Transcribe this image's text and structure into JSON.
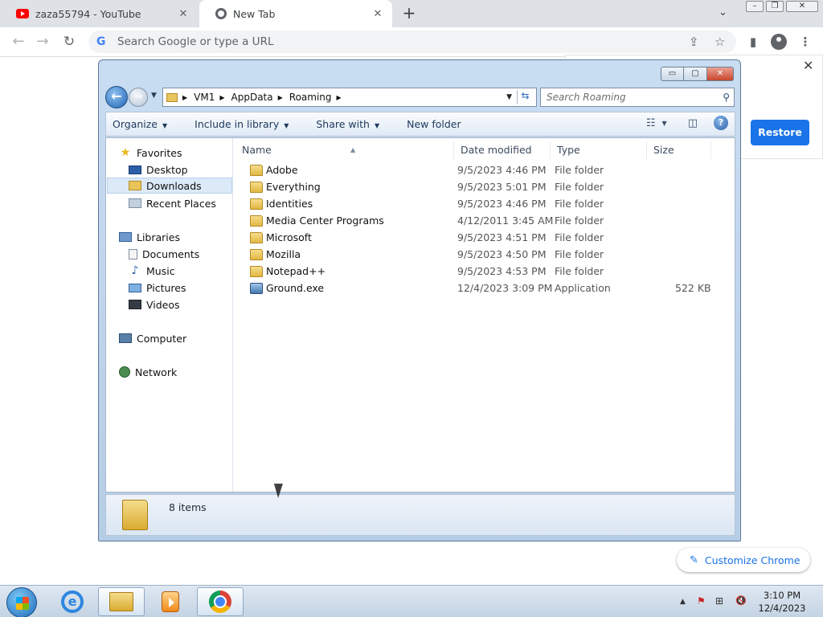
{
  "chrome": {
    "tabs": [
      {
        "title": "zaza55794 - YouTube",
        "close": "✕"
      },
      {
        "title": "New Tab",
        "close": "✕"
      }
    ],
    "new_tab": "+",
    "tab_search": "⌄",
    "window_controls": {
      "minimize": "–",
      "maximize": "❐",
      "close": "✕"
    },
    "nav": {
      "back": "←",
      "forward": "→",
      "reload": "↻"
    },
    "omnibox": {
      "g": "G",
      "placeholder": "Search Google or type a URL"
    },
    "toolbar_icons": {
      "share": "⇪",
      "bookmark": "☆",
      "sidepanel": "▮",
      "menu": "⋮"
    }
  },
  "ntp": {
    "close": "✕",
    "restore_label": "Restore",
    "customize_label": "Customize Chrome",
    "pencil": "✎"
  },
  "explorer": {
    "caption": {
      "minimize": "▭",
      "maximize": "▢",
      "close": "✕"
    },
    "breadcrumb": [
      "VM1",
      "AppData",
      "Roaming"
    ],
    "breadcrumb_sep": "▶",
    "back": "←",
    "forward": "→",
    "search_placeholder": "Search Roaming",
    "search_icon": "⚲",
    "commands": [
      {
        "label": "Organize",
        "caret": "▼"
      },
      {
        "label": "Include in library",
        "caret": "▼"
      },
      {
        "label": "Share with",
        "caret": "▼"
      },
      {
        "label": "New folder",
        "caret": ""
      }
    ],
    "view_icons": {
      "views": "☷",
      "views_caret": "▼",
      "preview": "◫",
      "help": "?"
    },
    "nav_pane": {
      "favorites": {
        "label": "Favorites",
        "items": [
          "Desktop",
          "Downloads",
          "Recent Places"
        ]
      },
      "libraries": {
        "label": "Libraries",
        "items": [
          "Documents",
          "Music",
          "Pictures",
          "Videos"
        ]
      },
      "computer": "Computer",
      "network": "Network"
    },
    "columns": [
      "Name",
      "Date modified",
      "Type",
      "Size"
    ],
    "files": [
      {
        "name": "Adobe",
        "date": "9/5/2023 4:46 PM",
        "type": "File folder",
        "size": "",
        "icon": "folder-icon"
      },
      {
        "name": "Everything",
        "date": "9/5/2023 5:01 PM",
        "type": "File folder",
        "size": "",
        "icon": "folder-icon"
      },
      {
        "name": "Identities",
        "date": "9/5/2023 4:46 PM",
        "type": "File folder",
        "size": "",
        "icon": "folder-icon"
      },
      {
        "name": "Media Center Programs",
        "date": "4/12/2011 3:45 AM",
        "type": "File folder",
        "size": "",
        "icon": "folder-icon"
      },
      {
        "name": "Microsoft",
        "date": "9/5/2023 4:51 PM",
        "type": "File folder",
        "size": "",
        "icon": "folder-icon"
      },
      {
        "name": "Mozilla",
        "date": "9/5/2023 4:50 PM",
        "type": "File folder",
        "size": "",
        "icon": "folder-icon"
      },
      {
        "name": "Notepad++",
        "date": "9/5/2023 4:53 PM",
        "type": "File folder",
        "size": "",
        "icon": "folder-icon"
      },
      {
        "name": "Ground.exe",
        "date": "12/4/2023 3:09 PM",
        "type": "Application",
        "size": "522 KB",
        "icon": "application-icon"
      }
    ],
    "status": "8 items"
  },
  "taskbar": {
    "ie_letter": "e",
    "tray": {
      "up": "▲",
      "flag": "⚑",
      "network": "⊞",
      "volume": "🔇"
    },
    "time": "3:10 PM",
    "date": "12/4/2023"
  }
}
